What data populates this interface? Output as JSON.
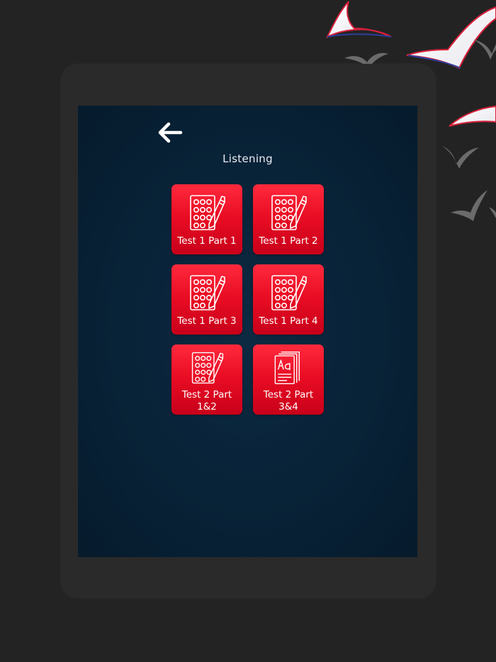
{
  "screen": {
    "title": "Listening",
    "back_icon": "arrow-left-icon"
  },
  "tiles": [
    {
      "label": "Test 1 Part 1",
      "icon": "answer-sheet-icon"
    },
    {
      "label": "Test 1 Part 2",
      "icon": "answer-sheet-icon"
    },
    {
      "label": "Test 1 Part 3",
      "icon": "answer-sheet-icon"
    },
    {
      "label": "Test 1 Part 4",
      "icon": "answer-sheet-icon"
    },
    {
      "label_line1": "Test 2 Part",
      "label_line2": "1&2",
      "icon": "answer-sheet-icon"
    },
    {
      "label_line1": "Test 2 Part",
      "label_line2": "3&4",
      "icon": "books-icon"
    }
  ],
  "colors": {
    "background": "#232323",
    "tablet": "#2a2a2a",
    "screen": "#082237",
    "tile": "#ea0d24",
    "text": "#ffffff"
  }
}
